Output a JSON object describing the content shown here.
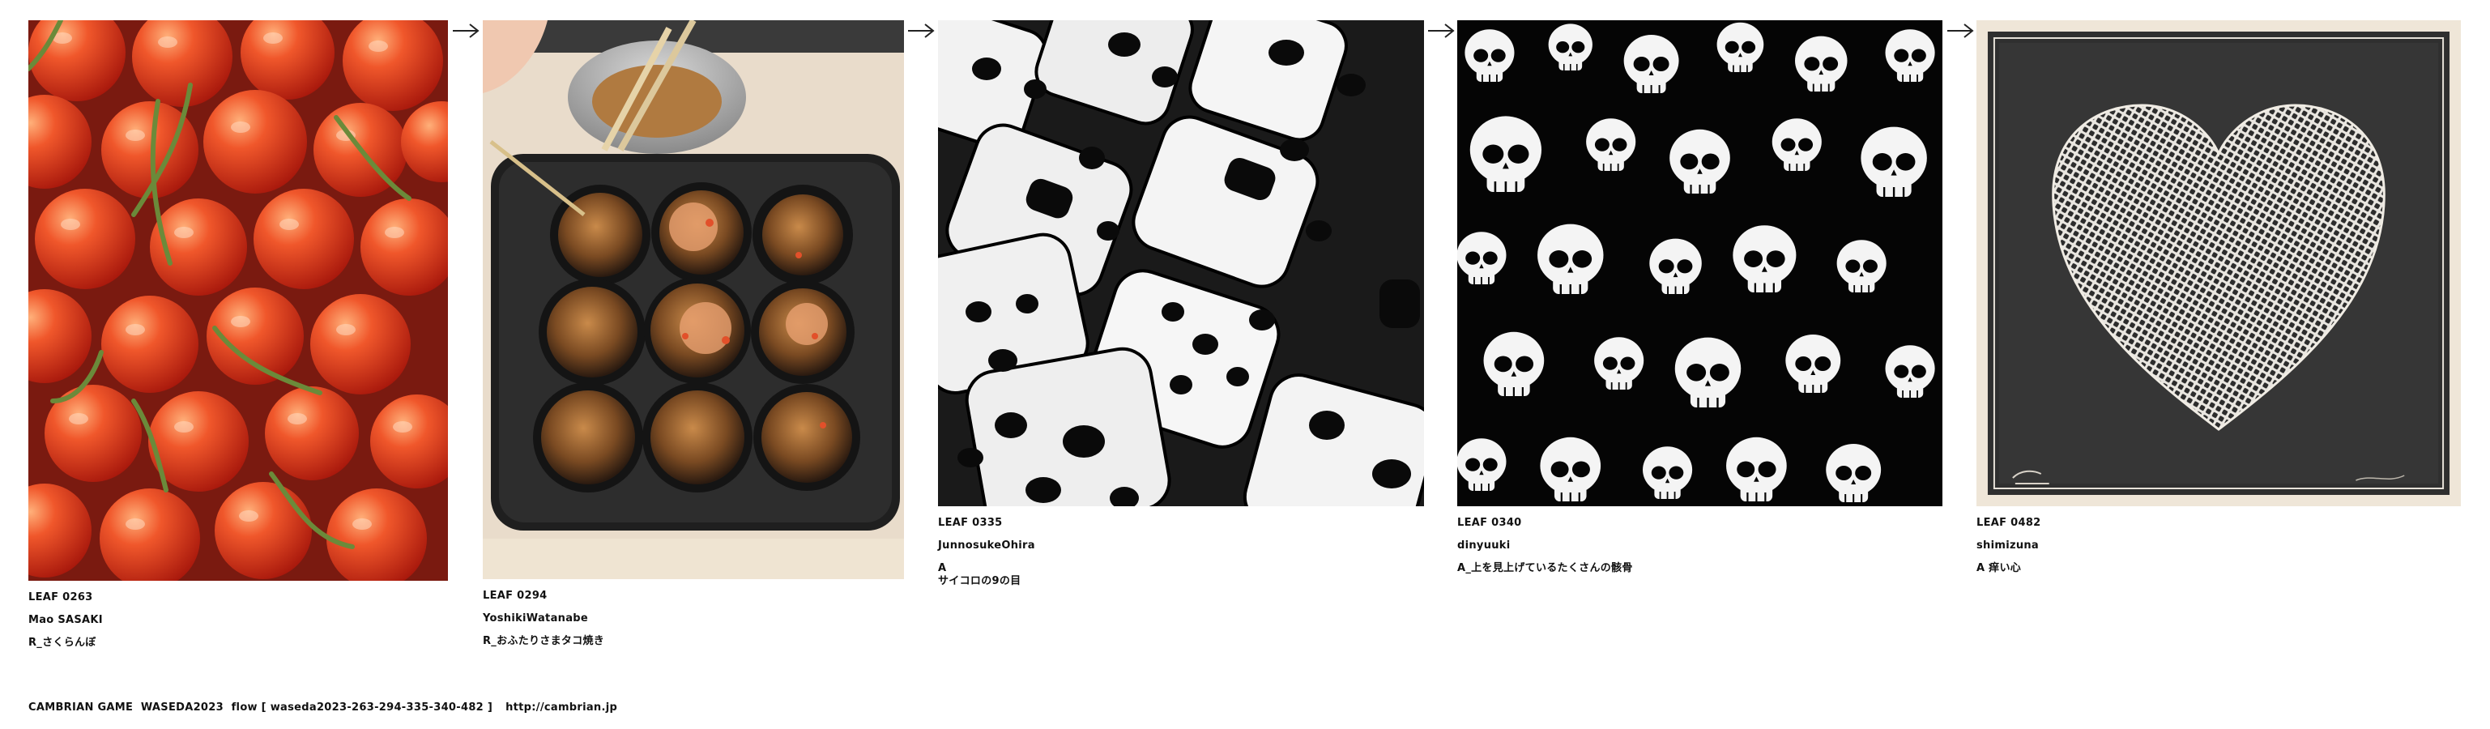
{
  "leaves": [
    {
      "code": "LEAF 0263",
      "author": "Mao SASAKI",
      "title": "R_さくらんぼ",
      "image": "cherries-photo"
    },
    {
      "code": "LEAF 0294",
      "author": "YoshikiWatanabe",
      "title": "R_おふたりさまタコ焼き",
      "image": "takoyaki-pan-photo"
    },
    {
      "code": "LEAF 0335",
      "author": "JunnosukeOhira",
      "title": "A",
      "title2": "サイコロの9の目",
      "image": "white-dice-pattern"
    },
    {
      "code": "LEAF 0340",
      "author": "dinyuuki",
      "title": "A_上を見上げているたくさんの骸骨",
      "image": "skulls-pattern"
    },
    {
      "code": "LEAF 0482",
      "author": "shimizuna",
      "title": "A 痒い心",
      "image": "mesh-heart-print"
    }
  ],
  "footer": {
    "text": "CAMBRIAN GAME  WASEDA2023  flow [ waseda2023-263-294-335-340-482 ]",
    "link": "http://cambrian.jp"
  },
  "colors": {
    "text": "#111111",
    "arrow": "#222222"
  }
}
